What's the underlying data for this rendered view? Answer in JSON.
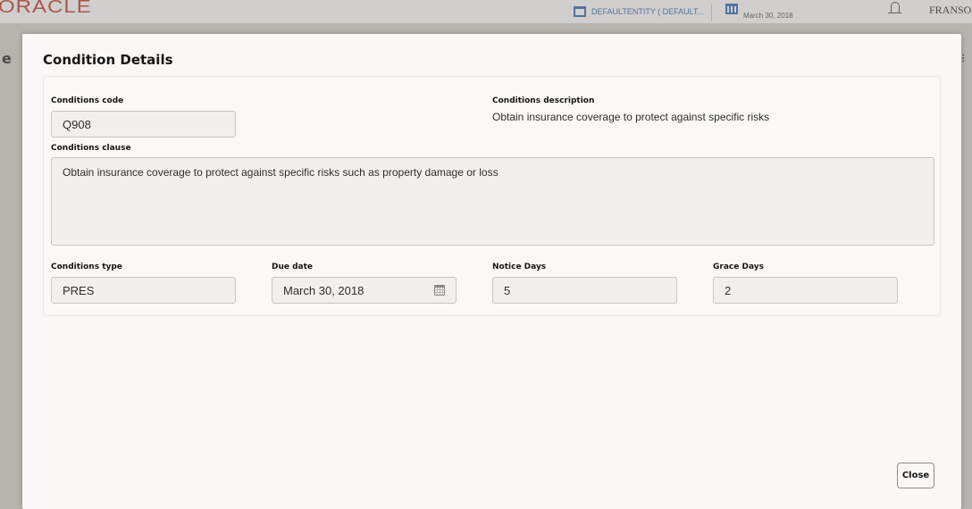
{
  "app": {
    "logo": "ORACLE",
    "entity": "DEFAULTENTITY ( DEFAULT...",
    "date": "March 30, 2018",
    "user": "FRANSO"
  },
  "background": {
    "left_letter": "e",
    "right_glyph": "⁝"
  },
  "modal": {
    "title": "Condition Details",
    "fields": {
      "conditions_code": {
        "label": "Conditions code",
        "value": "Q908"
      },
      "conditions_description": {
        "label": "Conditions description",
        "value": "Obtain insurance coverage to protect against specific risks"
      },
      "conditions_clause": {
        "label": "Conditions clause",
        "value": "Obtain insurance coverage to protect against specific risks such as property damage or loss"
      },
      "conditions_type": {
        "label": "Conditions type",
        "value": "PRES"
      },
      "due_date": {
        "label": "Due date",
        "value": "March 30, 2018"
      },
      "notice_days": {
        "label": "Notice Days",
        "value": "5"
      },
      "grace_days": {
        "label": "Grace Days",
        "value": "2"
      }
    },
    "close_label": "Close"
  },
  "colors": {
    "brand": "#c74634",
    "link": "#3f6fb5",
    "field_bg": "#f1f0ef",
    "modal_bg": "#f9f8f7"
  }
}
